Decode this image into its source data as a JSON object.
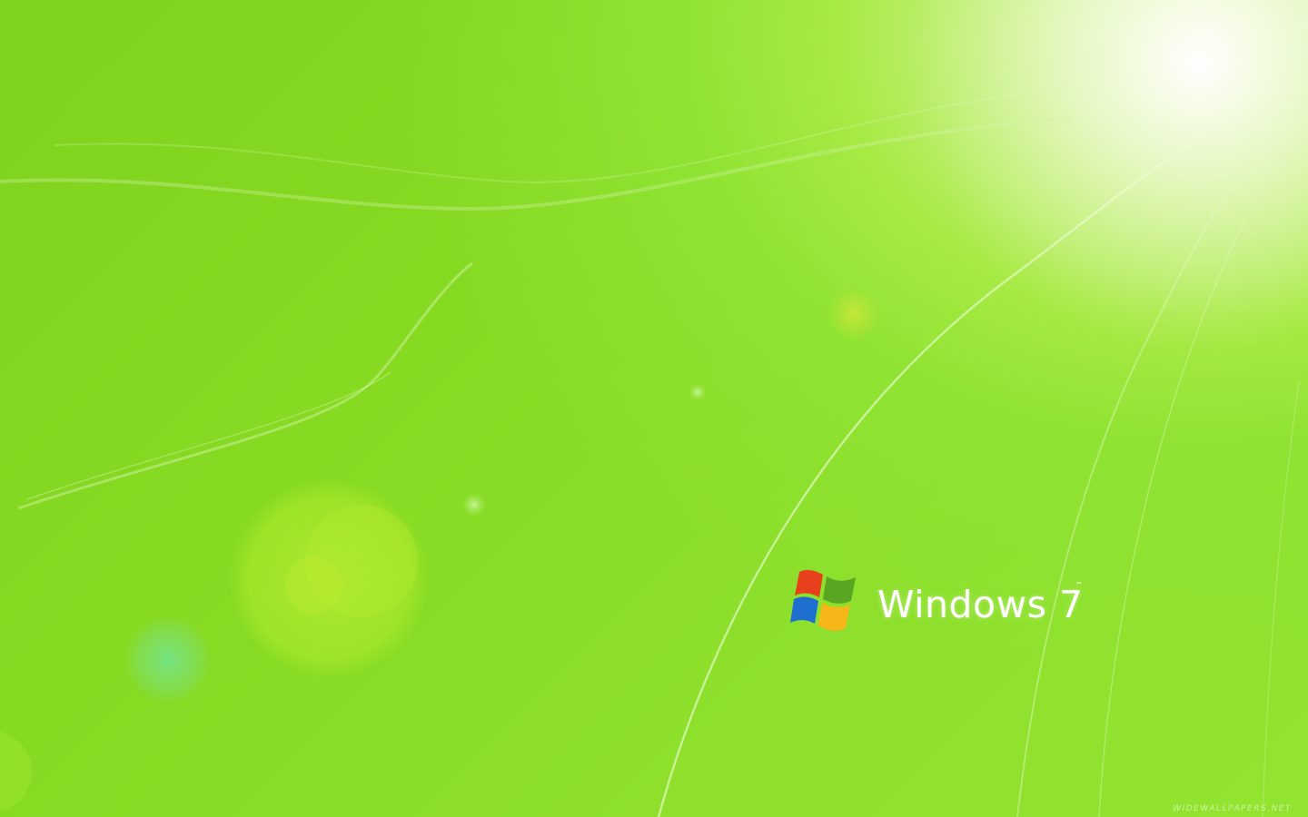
{
  "wallpaper": {
    "brand_text": "Windows 7",
    "trademark": "™",
    "watermark": "WIDEWALLPAPERS.NET",
    "colors": {
      "base_green": "#86da22",
      "glow": "#f6fbe8",
      "flag_red": "#e8401c",
      "flag_green": "#5aa521",
      "flag_blue": "#1f6fd1",
      "flag_yellow": "#f7b718"
    }
  }
}
